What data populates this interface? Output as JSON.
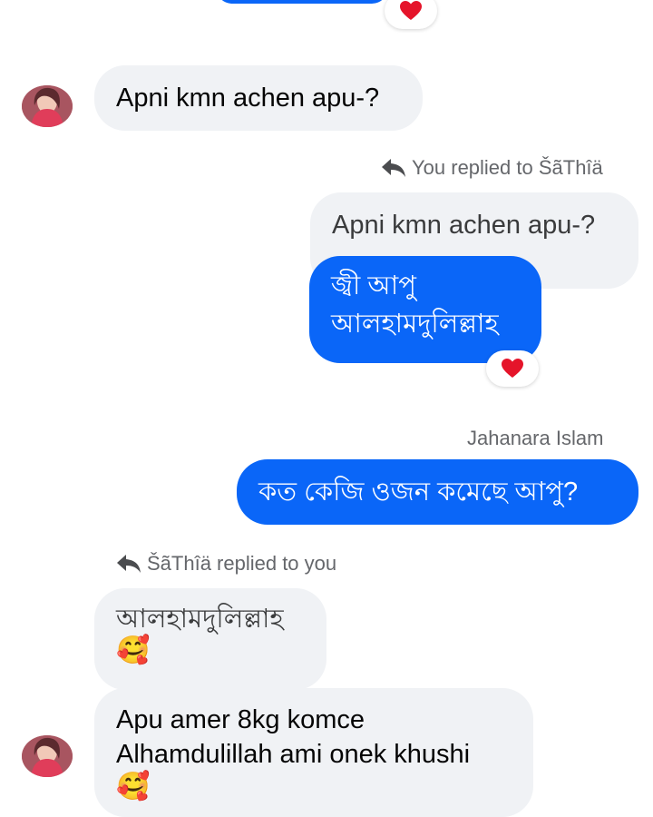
{
  "messages": {
    "m1": {
      "text": "Apni kmn achen apu-?"
    },
    "reply1": {
      "meta": "You replied to ŠãThîä",
      "quoted": "Apni kmn achen apu-?",
      "line1": "জ্বী আপু",
      "line2": "আলহামদুলিল্লাহ"
    },
    "m3": {
      "sender": "Jahanara Islam",
      "text": "কত কেজি ওজন কমেছে আপু?"
    },
    "reply2": {
      "meta": "ŠãThîä replied to you",
      "quoted": "আলহামদুলিল্লাহ",
      "quoted_emoji": "🥰",
      "line1": "Apu amer 8kg komce",
      "line2": "Alhamdulillah ami onek khushi",
      "emoji": "🥰"
    }
  },
  "reactions": {
    "heart_color": "#e5142a"
  },
  "colors": {
    "outgoing": "#0a66f8",
    "incoming": "#f0f2f5"
  }
}
